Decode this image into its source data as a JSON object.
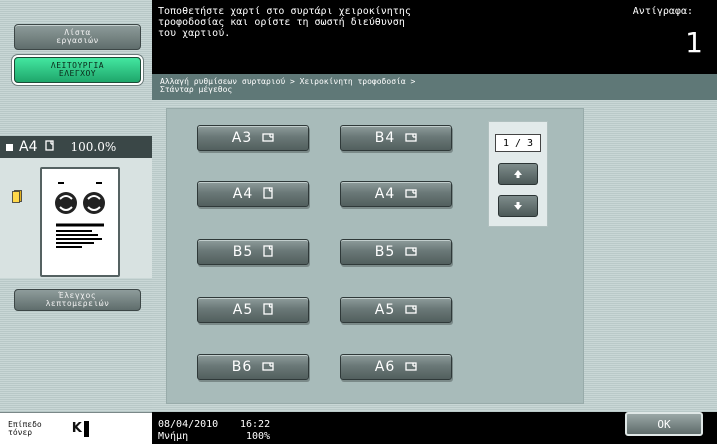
{
  "sidebar": {
    "jobs_button": "Λίστα\nεργασιών",
    "function_button": "ΛΕΙΤΟΥΡΓΙΑ\nΕΛΕΓΧΟΥ",
    "paper_size": "A4",
    "zoom": "100.0%",
    "detail_button": "Έλεγχος\nλεπτομερειών",
    "toner_label": "Επίπεδο\nτόνερ",
    "toner_color": "K"
  },
  "header": {
    "message": "Τοποθετήστε χαρτί στο συρτάρι χειροκίνητης\nτροφοδοσίας και ορίστε τη σωστή διεύθυνση\nτου χαρτιού.",
    "copies_label": "Αντίγραφα:",
    "copies_value": "1"
  },
  "breadcrumb": "Αλλαγή ρυθμίσεων συρταριού > Χειροκίνητη τροφοδοσία >\nΣτάνταρ μέγεθος",
  "size_buttons": [
    {
      "size": "A3",
      "orient": "landscape"
    },
    {
      "size": "B4",
      "orient": "landscape"
    },
    {
      "size": "A4",
      "orient": "portrait"
    },
    {
      "size": "A4",
      "orient": "landscape"
    },
    {
      "size": "B5",
      "orient": "portrait"
    },
    {
      "size": "B5",
      "orient": "landscape"
    },
    {
      "size": "A5",
      "orient": "portrait"
    },
    {
      "size": "A5",
      "orient": "landscape"
    },
    {
      "size": "B6",
      "orient": "landscape"
    },
    {
      "size": "A6",
      "orient": "landscape"
    }
  ],
  "pager": {
    "indicator": "1 / 3",
    "up_icon": "arrow-up-icon",
    "down_icon": "arrow-down-icon"
  },
  "status": {
    "date": "08/04/2010",
    "time": "16:22",
    "memory_label": "Μνήμη",
    "memory_value": "100%",
    "ok_button": "OK"
  },
  "colors": {
    "accent_green": "#2bc98a",
    "panel": "#a8bbba",
    "header_bg": "#000000",
    "breadcrumb_bg": "#5f7877"
  }
}
